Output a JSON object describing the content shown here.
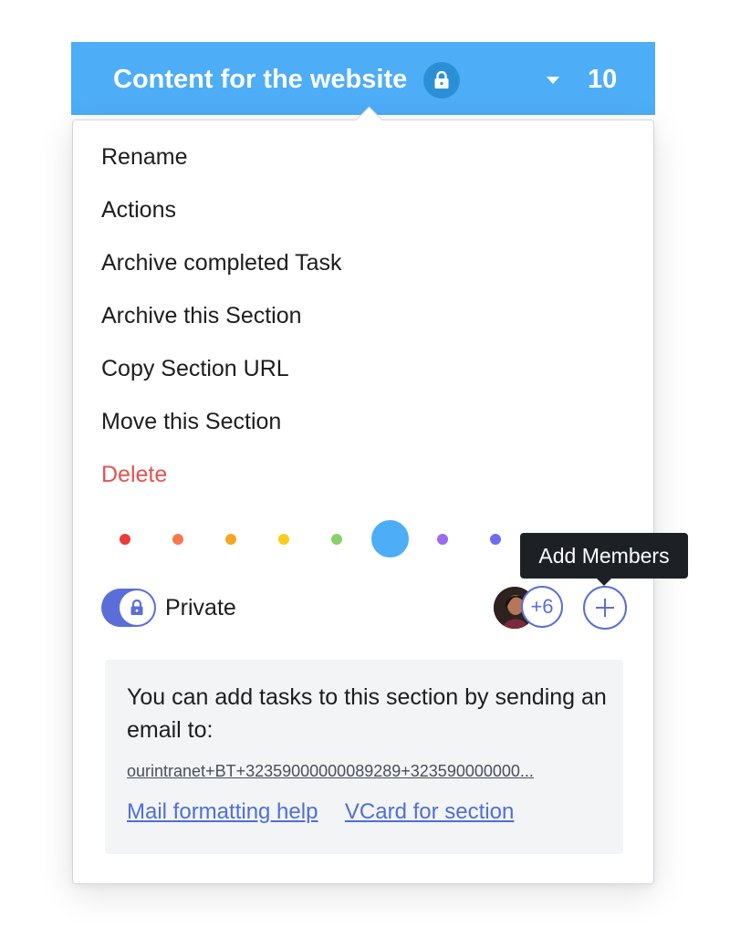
{
  "header": {
    "title": "Content for the website",
    "lock_icon": "lock-icon",
    "caret_icon": "caret-down-icon",
    "count": "10",
    "background": "#4dadf7"
  },
  "menu": {
    "items": [
      {
        "label": "Rename"
      },
      {
        "label": "Actions"
      },
      {
        "label": "Archive completed Task"
      },
      {
        "label": "Archive this Section"
      },
      {
        "label": "Copy Section URL"
      },
      {
        "label": "Move this Section"
      },
      {
        "label": "Delete",
        "danger": true,
        "color": "#e5524f"
      }
    ]
  },
  "colors": {
    "options": [
      "#ec3c3c",
      "#f5784e",
      "#f5a623",
      "#f8cd1c",
      "#8bd068",
      "#4dadf7",
      "#9a6cf2",
      "#6d6cf0"
    ],
    "selected_index": 5
  },
  "tooltip": {
    "text": "Add Members"
  },
  "privacy": {
    "label": "Private",
    "enabled": true,
    "accent": "#5b6ed8"
  },
  "members": {
    "more_count": "+6",
    "add_icon": "plus-icon"
  },
  "info": {
    "text": "You can add tasks to this section by sending an email to:",
    "email": "ourintranet+BT+32359000000089289+323590000000...",
    "links": {
      "mail_help": "Mail formatting help",
      "vcard": "VCard for section"
    }
  }
}
